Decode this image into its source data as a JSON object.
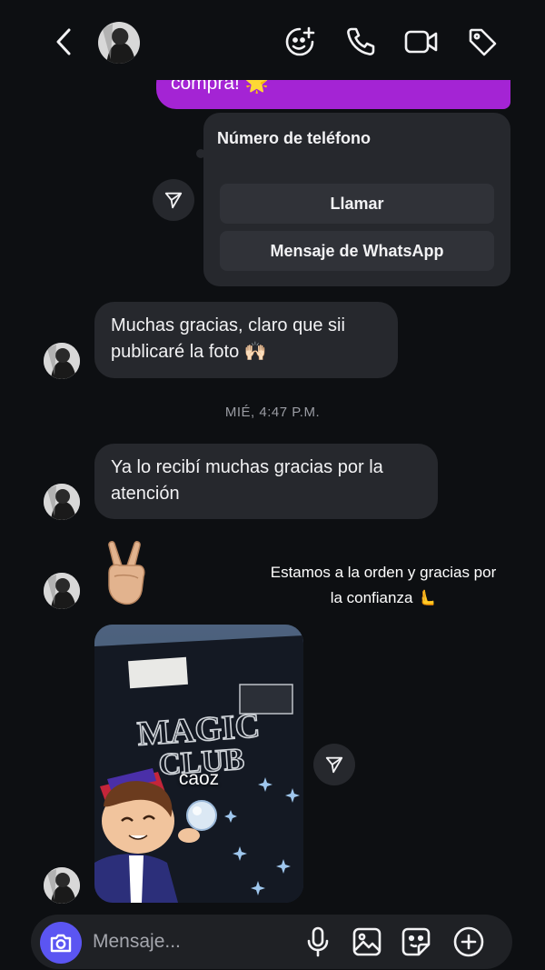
{
  "top_message": {
    "text": "compra! 🌟"
  },
  "contact_card": {
    "title": "Número de teléfono",
    "call_button": "Llamar",
    "whatsapp_button": "Mensaje de WhatsApp"
  },
  "messages": [
    {
      "line1": "Muchas gracias, claro que sii",
      "line2": "publicaré la foto 🙌🏻"
    },
    {
      "line1": "Ya lo recibí muchas gracias por la",
      "line2": "atención"
    }
  ],
  "timestamp": "MIÉ, 4:47 P.M.",
  "emoji_reply": "✌🏼",
  "story_note": {
    "line1": "Estamos a la orden y gracias por",
    "line2": "la confianza 🫷"
  },
  "photo": {
    "print_line1": "MAGIC",
    "print_line2": "CLUB",
    "caption": "caoz"
  },
  "composer": {
    "placeholder": "Mensaje..."
  },
  "colors": {
    "background": "#0d0f12",
    "bubble_incoming": "#26282d",
    "bubble_outgoing": "#a424d4",
    "camera_button": "#5b55f2"
  },
  "icons": [
    "back-arrow-icon",
    "effects-icon",
    "phone-icon",
    "video-camera-icon",
    "tag-icon",
    "send-icon",
    "camera-icon",
    "microphone-icon",
    "gallery-icon",
    "sticker-icon",
    "add-icon"
  ]
}
